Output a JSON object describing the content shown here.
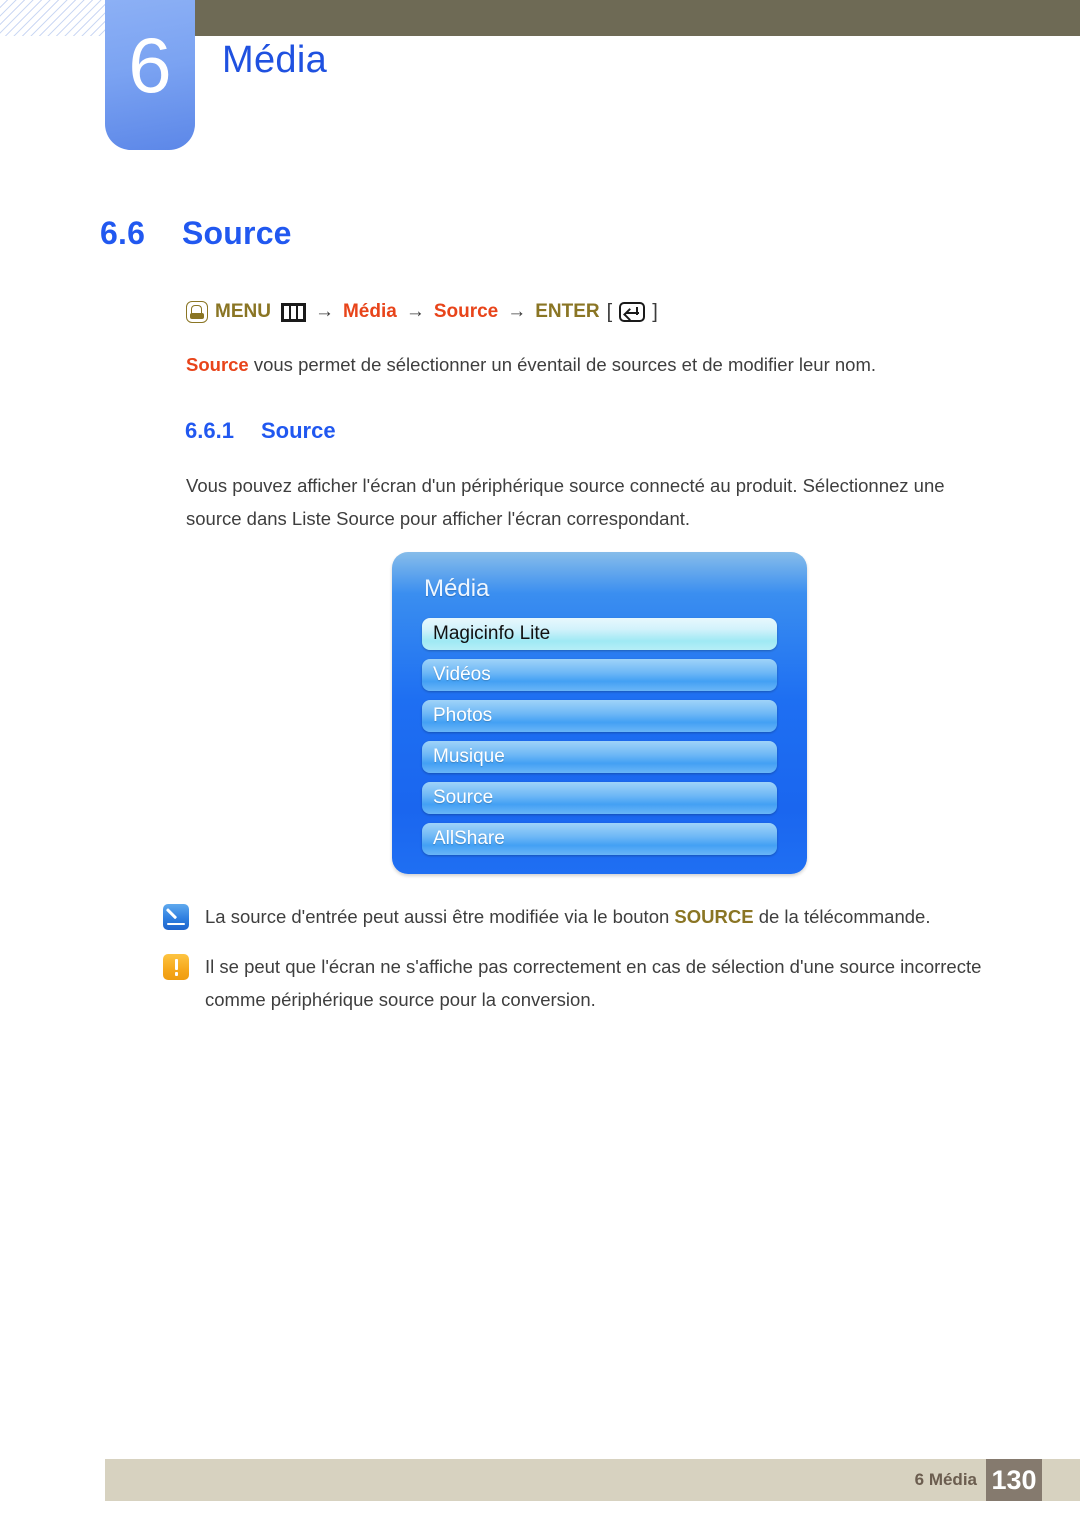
{
  "chapter": {
    "number": "6",
    "title": "Média"
  },
  "headings": {
    "section_number": "6.6",
    "section_title": "Source",
    "subsection_number": "6.6.1",
    "subsection_title": "Source"
  },
  "nav_path": {
    "hand_icon": "hand-press-icon",
    "menu_label": "MENU",
    "menu_icon": "menu-bars-icon",
    "arrow1": "→",
    "item1": "Média",
    "arrow2": "→",
    "item2": "Source",
    "arrow3": "→",
    "enter_label": "ENTER",
    "bracket_open": "[",
    "enter_icon": "enter-key-icon",
    "bracket_close": "]"
  },
  "lead": {
    "highlight": "Source",
    "rest": " vous permet de sélectionner un éventail de sources et de modifier leur nom."
  },
  "paragraph": "Vous pouvez afficher l'écran d'un périphérique source connecté au produit. Sélectionnez une source dans Liste Source pour afficher l'écran correspondant.",
  "osd": {
    "title": "Média",
    "items": [
      {
        "label": "Magicinfo Lite",
        "selected": true
      },
      {
        "label": "Vidéos",
        "selected": false
      },
      {
        "label": "Photos",
        "selected": false
      },
      {
        "label": "Musique",
        "selected": false
      },
      {
        "label": "Source",
        "selected": false
      },
      {
        "label": "AllShare",
        "selected": false
      }
    ]
  },
  "notes": [
    {
      "icon": "note-pencil-icon",
      "text_before": "La source d'entrée peut aussi être modifiée via le bouton ",
      "emphasis": "SOURCE",
      "text_after": " de la télécommande."
    },
    {
      "icon": "warning-exclamation-icon",
      "text": "Il se peut que l'écran ne s'affiche pas correctement en cas de sélection d'une source incorrecte comme périphérique source pour la conversion."
    }
  ],
  "footer": {
    "label": "6 Média",
    "page_number": "130"
  },
  "colors": {
    "heading_blue": "#2158f0",
    "accent_red": "#e8441a",
    "accent_olive": "#8a7524",
    "olive_bar": "#6e6a55",
    "tab_blue": "#7ba3f2",
    "footer_bg": "#d7d2c0",
    "footer_page_bg": "#857a6e"
  }
}
